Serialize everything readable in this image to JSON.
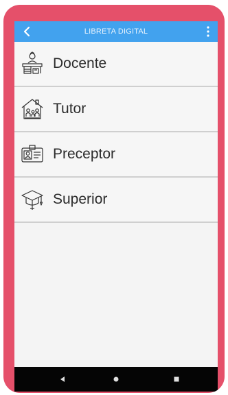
{
  "appbar": {
    "title": "LIBRETA DIGITAL",
    "back_icon": "chevron-left-icon",
    "menu_icon": "more-vert-icon",
    "color": "#42a2ee"
  },
  "menu": {
    "items": [
      {
        "label": "Docente",
        "icon": "teacher-desk-icon"
      },
      {
        "label": "Tutor",
        "icon": "family-home-icon"
      },
      {
        "label": "Preceptor",
        "icon": "id-card-icon"
      },
      {
        "label": "Superior",
        "icon": "graduation-cap-icon"
      }
    ]
  },
  "navbar": {
    "buttons": [
      "nav-back-icon",
      "nav-home-icon",
      "nav-recents-icon"
    ]
  },
  "frame_color": "#e5506a"
}
